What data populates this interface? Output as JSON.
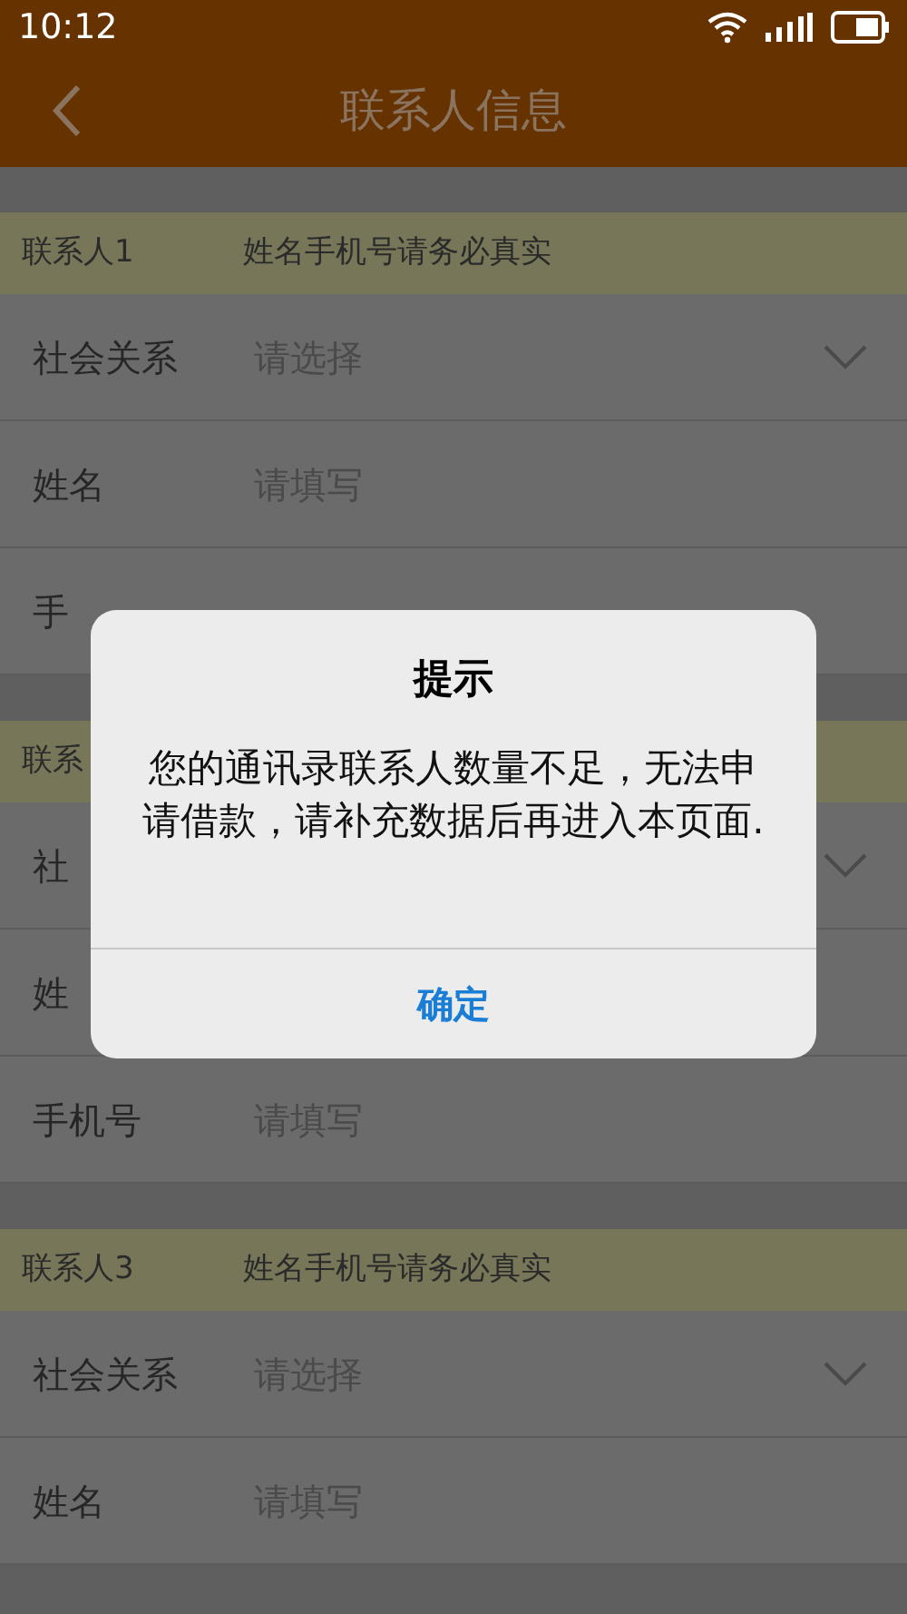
{
  "status_bar": {
    "time": "10:12"
  },
  "header": {
    "title": "联系人信息"
  },
  "sections": [
    {
      "title": "联系人1",
      "note": "姓名手机号请务必真实",
      "rows": [
        {
          "kind": "select",
          "label": "社会关系",
          "placeholder": "请选择"
        },
        {
          "kind": "text",
          "label": "姓名",
          "placeholder": "请填写"
        },
        {
          "kind": "text",
          "label": "手"
        }
      ]
    },
    {
      "title": "联系",
      "rows": [
        {
          "kind": "select",
          "label": "社"
        },
        {
          "kind": "text",
          "label": "姓"
        },
        {
          "kind": "text",
          "label": "手机号",
          "placeholder": "请填写"
        }
      ]
    },
    {
      "title": "联系人3",
      "note": "姓名手机号请务必真实",
      "rows": [
        {
          "kind": "select",
          "label": "社会关系",
          "placeholder": "请选择"
        },
        {
          "kind": "text",
          "label": "姓名",
          "placeholder": "请填写"
        }
      ]
    }
  ],
  "dialog": {
    "title": "提示",
    "message": "您的通讯录联系人数量不足，无法申请借款，请补充数据后再进入本页面.",
    "button": "确定"
  }
}
